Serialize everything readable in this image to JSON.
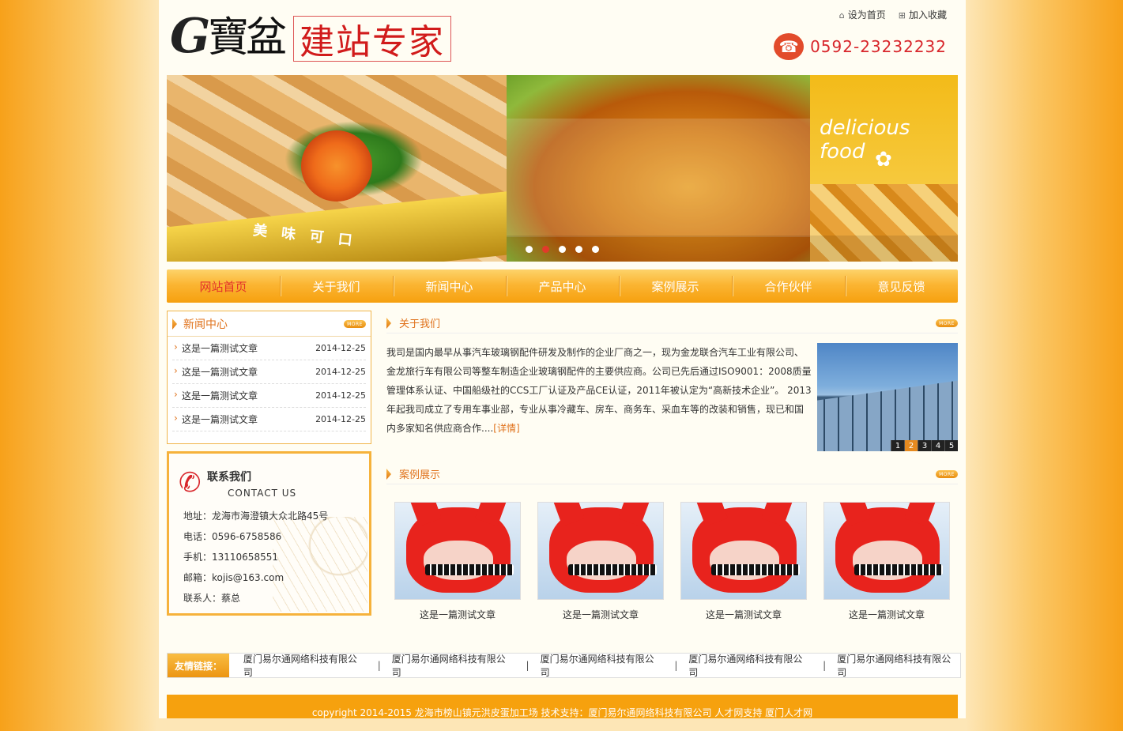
{
  "header": {
    "logo_g": "G",
    "logo_bao": "寶盆",
    "logo_slogan": "建站专家",
    "set_home": "设为首页",
    "add_favorite": "加入收藏",
    "phone": "0592-23232232"
  },
  "banner": {
    "ribbon_text": "美味可口",
    "side_text": "delicious food",
    "slides": [
      1,
      2,
      3,
      4,
      5
    ],
    "active_slide": 2
  },
  "nav": {
    "items": [
      "网站首页",
      "关于我们",
      "新闻中心",
      "产品中心",
      "案例展示",
      "合作伙伴",
      "意见反馈"
    ]
  },
  "news": {
    "title": "新闻中心",
    "more": "MORE",
    "rows": [
      {
        "title": "这是一篇测试文章",
        "date": "2014-12-25"
      },
      {
        "title": "这是一篇测试文章",
        "date": "2014-12-25"
      },
      {
        "title": "这是一篇测试文章",
        "date": "2014-12-25"
      },
      {
        "title": "这是一篇测试文章",
        "date": "2014-12-25"
      }
    ]
  },
  "contact": {
    "title": "联系我们",
    "title_en": "CONTACT US",
    "address": "地址：龙海市海澄镇大众北路45号",
    "tel": "电话：0596-6758586",
    "mobile": "手机：13110658551",
    "email": "邮箱：kojis@163.com",
    "person": "联系人：蔡总"
  },
  "about": {
    "title": "关于我们",
    "more": "MORE",
    "text": "我司是国内最早从事汽车玻璃钢配件研发及制作的企业厂商之一，现为金龙联合汽车工业有限公司、金龙旅行车有限公司等整车制造企业玻璃钢配件的主要供应商。公司已先后通过ISO9001：2008质量管理体系认证、中国船级社的CCS工厂认证及产品CE认证，2011年被认定为“高新技术企业”。 2013年起我司成立了专用车事业部，专业从事冷藏车、房车、商务车、采血车等的改装和销售，现已和国内多家知名供应商合作....",
    "detail": "[详情]",
    "pager": [
      "1",
      "2",
      "3",
      "4",
      "5"
    ]
  },
  "cases": {
    "title": "案例展示",
    "more": "MORE",
    "items": [
      "这是一篇测试文章",
      "这是一篇测试文章",
      "这是一篇测试文章",
      "这是一篇测试文章"
    ]
  },
  "links": {
    "label": "友情链接：",
    "items": [
      "厦门易尔通网络科技有限公司",
      "厦门易尔通网络科技有限公司",
      "厦门易尔通网络科技有限公司",
      "厦门易尔通网络科技有限公司",
      "厦门易尔通网络科技有限公司"
    ]
  },
  "footer": {
    "text": "copyright 2014-2015 龙海市榜山镇元洪皮蛋加工场 技术支持：厦门易尔通网络科技有限公司 人才网支持 厦门人才网"
  }
}
